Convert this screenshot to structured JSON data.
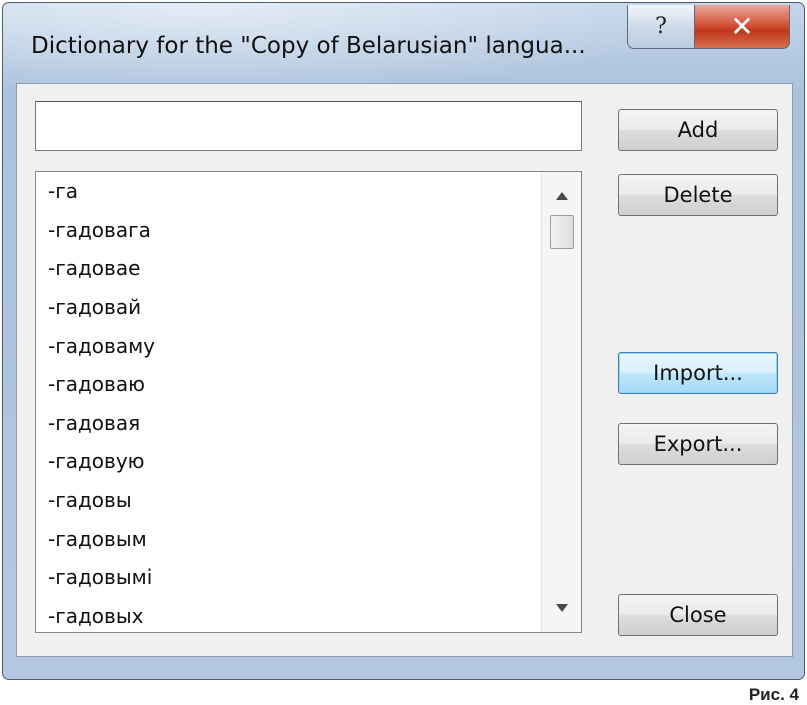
{
  "dialog": {
    "title": "Dictionary for the \"Copy of Belarusian\" langua...",
    "help_glyph": "?",
    "close_glyph": "✕"
  },
  "word_input": {
    "value": "",
    "placeholder": ""
  },
  "word_list": {
    "items": [
      "-га",
      "-гадовага",
      "-гадовае",
      "-гадовай",
      "-гадоваму",
      "-гадоваю",
      "-гадовая",
      "-гадовую",
      "-гадовы",
      "-гадовым",
      "-гадовымі",
      "-гадовых"
    ],
    "scroll_up_icon": "scroll-up-arrow",
    "scroll_down_icon": "scroll-down-arrow"
  },
  "buttons": {
    "add": "Add",
    "delete": "Delete",
    "import": "Import...",
    "export": "Export...",
    "close": "Close"
  },
  "caption": "Рис. 4",
  "colors": {
    "close_button": "#c8452b",
    "default_button_border": "#3c7fb1",
    "frame": "#b7cbe2"
  }
}
